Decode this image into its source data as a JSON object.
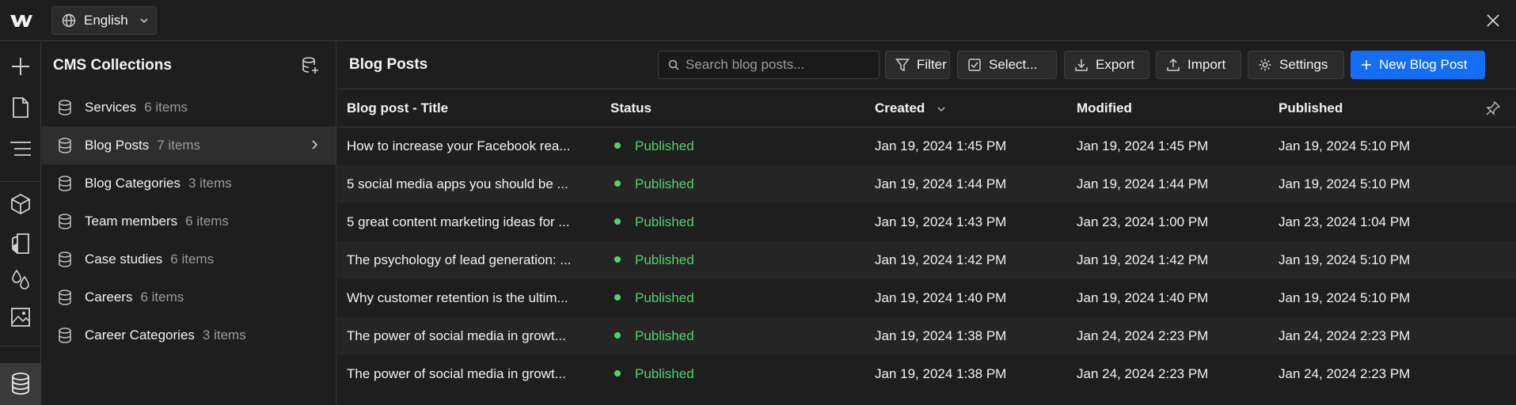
{
  "topbar": {
    "logo_icon": "webflow-logo-icon",
    "language": "English",
    "close_icon": "close-icon"
  },
  "rail": {
    "icons": [
      "add-icon",
      "page-icon",
      "navigator-icon",
      "components-icon",
      "style-manager-icon",
      "variables-icon",
      "assets-icon",
      "cms-icon"
    ]
  },
  "collections": {
    "title": "CMS Collections",
    "items": [
      {
        "label": "Services",
        "count": "6 items"
      },
      {
        "label": "Blog Posts",
        "count": "7 items"
      },
      {
        "label": "Blog Categories",
        "count": "3 items"
      },
      {
        "label": "Team members",
        "count": "6 items"
      },
      {
        "label": "Case studies",
        "count": "6 items"
      },
      {
        "label": "Careers",
        "count": "6 items"
      },
      {
        "label": "Career Categories",
        "count": "3 items"
      }
    ]
  },
  "main": {
    "title": "Blog Posts",
    "search_placeholder": "Search blog posts...",
    "toolbar": {
      "filter": "Filter",
      "select": "Select...",
      "export": "Export",
      "import": "Import",
      "settings": "Settings",
      "new_post": "New Blog Post"
    },
    "columns": [
      "Blog post - Title",
      "Status",
      "Created",
      "Modified",
      "Published"
    ],
    "rows": [
      {
        "title": "How to increase your Facebook rea...",
        "status": "Published",
        "created": "Jan 19, 2024 1:45 PM",
        "modified": "Jan 19, 2024 1:45 PM",
        "published": "Jan 19, 2024 5:10 PM"
      },
      {
        "title": "5 social media apps you should be ...",
        "status": "Published",
        "created": "Jan 19, 2024 1:44 PM",
        "modified": "Jan 19, 2024 1:44 PM",
        "published": "Jan 19, 2024 5:10 PM"
      },
      {
        "title": "5 great content marketing ideas for ...",
        "status": "Published",
        "created": "Jan 19, 2024 1:43 PM",
        "modified": "Jan 23, 2024 1:00 PM",
        "published": "Jan 23, 2024 1:04 PM"
      },
      {
        "title": "The psychology of lead generation: ...",
        "status": "Published",
        "created": "Jan 19, 2024 1:42 PM",
        "modified": "Jan 19, 2024 1:42 PM",
        "published": "Jan 19, 2024 5:10 PM"
      },
      {
        "title": "Why customer retention is the ultim...",
        "status": "Published",
        "created": "Jan 19, 2024 1:40 PM",
        "modified": "Jan 19, 2024 1:40 PM",
        "published": "Jan 19, 2024 5:10 PM"
      },
      {
        "title": "The power of social media in growt...",
        "status": "Published",
        "created": "Jan 19, 2024 1:38 PM",
        "modified": "Jan 24, 2024 2:23 PM",
        "published": "Jan 24, 2024 2:23 PM"
      },
      {
        "title": "The power of social media in growt...",
        "status": "Published",
        "created": "Jan 19, 2024 1:38 PM",
        "modified": "Jan 24, 2024 2:23 PM",
        "published": "Jan 24, 2024 2:23 PM"
      }
    ]
  },
  "colors": {
    "accent": "#146ef5",
    "published": "#4fd270",
    "background": "#1e1e1e"
  }
}
